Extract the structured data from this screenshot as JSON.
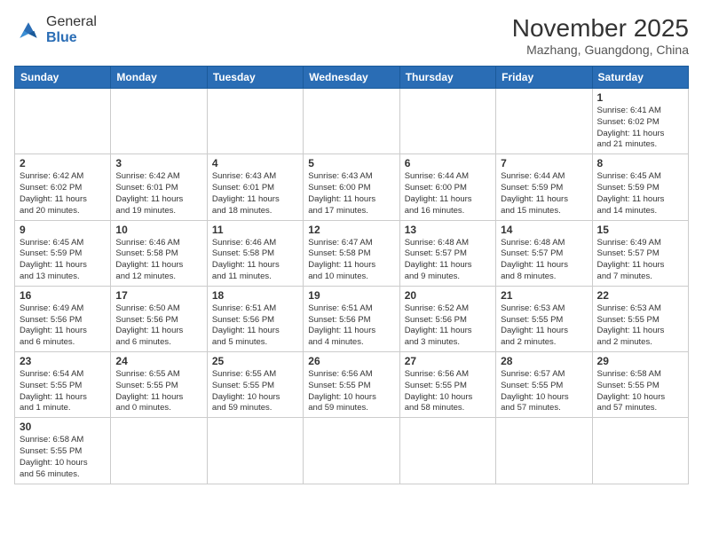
{
  "logo": {
    "text_general": "General",
    "text_blue": "Blue"
  },
  "header": {
    "month": "November 2025",
    "location": "Mazhang, Guangdong, China"
  },
  "weekdays": [
    "Sunday",
    "Monday",
    "Tuesday",
    "Wednesday",
    "Thursday",
    "Friday",
    "Saturday"
  ],
  "weeks": [
    [
      {
        "day": "",
        "info": ""
      },
      {
        "day": "",
        "info": ""
      },
      {
        "day": "",
        "info": ""
      },
      {
        "day": "",
        "info": ""
      },
      {
        "day": "",
        "info": ""
      },
      {
        "day": "",
        "info": ""
      },
      {
        "day": "1",
        "info": "Sunrise: 6:41 AM\nSunset: 6:02 PM\nDaylight: 11 hours\nand 21 minutes."
      }
    ],
    [
      {
        "day": "2",
        "info": "Sunrise: 6:42 AM\nSunset: 6:02 PM\nDaylight: 11 hours\nand 20 minutes."
      },
      {
        "day": "3",
        "info": "Sunrise: 6:42 AM\nSunset: 6:01 PM\nDaylight: 11 hours\nand 19 minutes."
      },
      {
        "day": "4",
        "info": "Sunrise: 6:43 AM\nSunset: 6:01 PM\nDaylight: 11 hours\nand 18 minutes."
      },
      {
        "day": "5",
        "info": "Sunrise: 6:43 AM\nSunset: 6:00 PM\nDaylight: 11 hours\nand 17 minutes."
      },
      {
        "day": "6",
        "info": "Sunrise: 6:44 AM\nSunset: 6:00 PM\nDaylight: 11 hours\nand 16 minutes."
      },
      {
        "day": "7",
        "info": "Sunrise: 6:44 AM\nSunset: 5:59 PM\nDaylight: 11 hours\nand 15 minutes."
      },
      {
        "day": "8",
        "info": "Sunrise: 6:45 AM\nSunset: 5:59 PM\nDaylight: 11 hours\nand 14 minutes."
      }
    ],
    [
      {
        "day": "9",
        "info": "Sunrise: 6:45 AM\nSunset: 5:59 PM\nDaylight: 11 hours\nand 13 minutes."
      },
      {
        "day": "10",
        "info": "Sunrise: 6:46 AM\nSunset: 5:58 PM\nDaylight: 11 hours\nand 12 minutes."
      },
      {
        "day": "11",
        "info": "Sunrise: 6:46 AM\nSunset: 5:58 PM\nDaylight: 11 hours\nand 11 minutes."
      },
      {
        "day": "12",
        "info": "Sunrise: 6:47 AM\nSunset: 5:58 PM\nDaylight: 11 hours\nand 10 minutes."
      },
      {
        "day": "13",
        "info": "Sunrise: 6:48 AM\nSunset: 5:57 PM\nDaylight: 11 hours\nand 9 minutes."
      },
      {
        "day": "14",
        "info": "Sunrise: 6:48 AM\nSunset: 5:57 PM\nDaylight: 11 hours\nand 8 minutes."
      },
      {
        "day": "15",
        "info": "Sunrise: 6:49 AM\nSunset: 5:57 PM\nDaylight: 11 hours\nand 7 minutes."
      }
    ],
    [
      {
        "day": "16",
        "info": "Sunrise: 6:49 AM\nSunset: 5:56 PM\nDaylight: 11 hours\nand 6 minutes."
      },
      {
        "day": "17",
        "info": "Sunrise: 6:50 AM\nSunset: 5:56 PM\nDaylight: 11 hours\nand 6 minutes."
      },
      {
        "day": "18",
        "info": "Sunrise: 6:51 AM\nSunset: 5:56 PM\nDaylight: 11 hours\nand 5 minutes."
      },
      {
        "day": "19",
        "info": "Sunrise: 6:51 AM\nSunset: 5:56 PM\nDaylight: 11 hours\nand 4 minutes."
      },
      {
        "day": "20",
        "info": "Sunrise: 6:52 AM\nSunset: 5:56 PM\nDaylight: 11 hours\nand 3 minutes."
      },
      {
        "day": "21",
        "info": "Sunrise: 6:53 AM\nSunset: 5:55 PM\nDaylight: 11 hours\nand 2 minutes."
      },
      {
        "day": "22",
        "info": "Sunrise: 6:53 AM\nSunset: 5:55 PM\nDaylight: 11 hours\nand 2 minutes."
      }
    ],
    [
      {
        "day": "23",
        "info": "Sunrise: 6:54 AM\nSunset: 5:55 PM\nDaylight: 11 hours\nand 1 minute."
      },
      {
        "day": "24",
        "info": "Sunrise: 6:55 AM\nSunset: 5:55 PM\nDaylight: 11 hours\nand 0 minutes."
      },
      {
        "day": "25",
        "info": "Sunrise: 6:55 AM\nSunset: 5:55 PM\nDaylight: 10 hours\nand 59 minutes."
      },
      {
        "day": "26",
        "info": "Sunrise: 6:56 AM\nSunset: 5:55 PM\nDaylight: 10 hours\nand 59 minutes."
      },
      {
        "day": "27",
        "info": "Sunrise: 6:56 AM\nSunset: 5:55 PM\nDaylight: 10 hours\nand 58 minutes."
      },
      {
        "day": "28",
        "info": "Sunrise: 6:57 AM\nSunset: 5:55 PM\nDaylight: 10 hours\nand 57 minutes."
      },
      {
        "day": "29",
        "info": "Sunrise: 6:58 AM\nSunset: 5:55 PM\nDaylight: 10 hours\nand 57 minutes."
      }
    ],
    [
      {
        "day": "30",
        "info": "Sunrise: 6:58 AM\nSunset: 5:55 PM\nDaylight: 10 hours\nand 56 minutes."
      },
      {
        "day": "",
        "info": ""
      },
      {
        "day": "",
        "info": ""
      },
      {
        "day": "",
        "info": ""
      },
      {
        "day": "",
        "info": ""
      },
      {
        "day": "",
        "info": ""
      },
      {
        "day": "",
        "info": ""
      }
    ]
  ]
}
